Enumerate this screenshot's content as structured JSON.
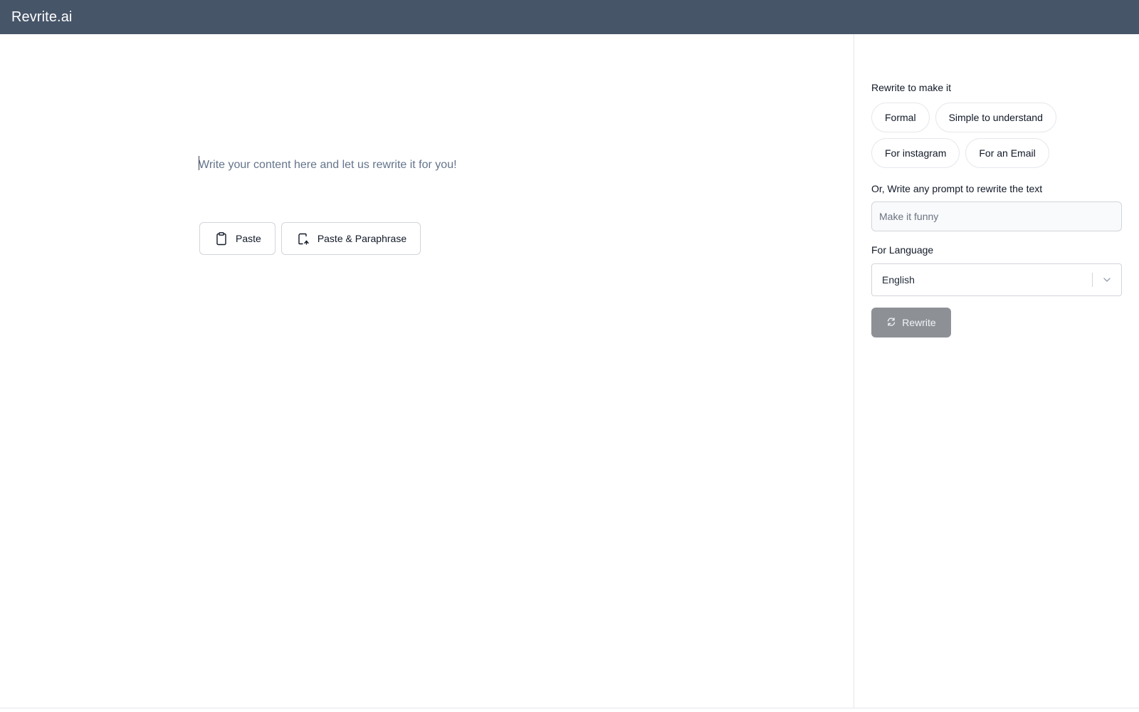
{
  "app": {
    "brand": "Revrite.ai",
    "colors": {
      "topbar": "#475569",
      "rewrite_button": "#8d9196",
      "border": "#d1d5db"
    }
  },
  "editor": {
    "placeholder": "Write your content here and let us rewrite it for you!",
    "value": "",
    "buttons": [
      {
        "label": "Paste",
        "icon": "clipboard-icon"
      },
      {
        "label": "Paste & Paraphrase",
        "icon": "paste-paraphrase-icon"
      }
    ]
  },
  "sidebar": {
    "tone_label": "Rewrite to make it",
    "tone_chips": [
      {
        "label": "Formal"
      },
      {
        "label": "Simple to understand"
      },
      {
        "label": "For instagram"
      },
      {
        "label": "For an Email"
      }
    ],
    "prompt_label": "Or, Write any prompt to rewrite the text",
    "prompt_placeholder": "Make it funny",
    "prompt_value": "",
    "language_label": "For Language",
    "language_selected": "English",
    "rewrite_label": "Rewrite",
    "rewrite_icon": "refresh-icon",
    "select_icon": "chevron-down-icon"
  }
}
